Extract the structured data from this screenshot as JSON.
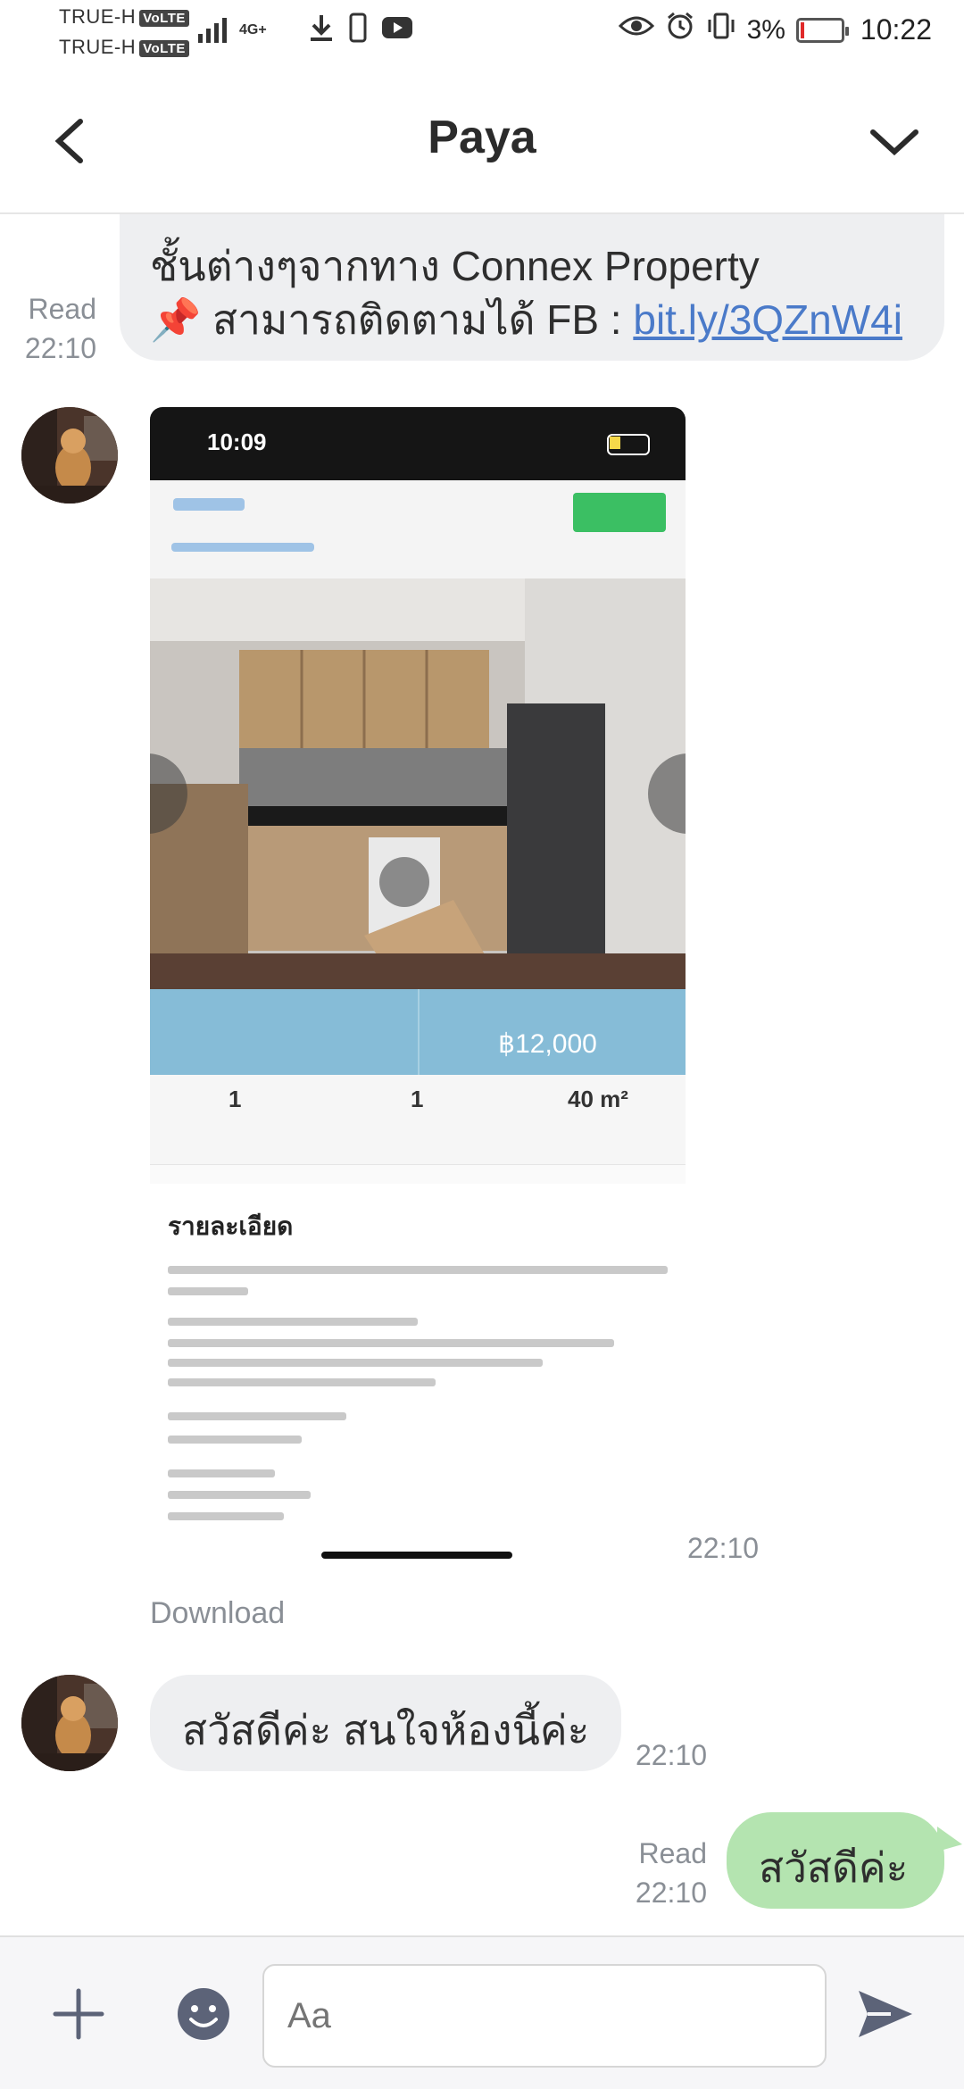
{
  "status_bar": {
    "carrier_1": "TRUE-H",
    "carrier_2": "TRUE-H",
    "volte": "VoLTE",
    "network": "4G+",
    "battery_percent": "3%",
    "time": "10:22"
  },
  "header": {
    "title": "Paya"
  },
  "messages": {
    "m1": {
      "line1": "ชั้นต่างๆจากทาง Connex Property",
      "line2_prefix": "📌 สามารถติดตามได้ FB : ",
      "link": "bit.ly/3QZnW4i",
      "status": "Read",
      "time": "22:10"
    },
    "m2": {
      "photo": {
        "phone_time": "10:09",
        "price": "฿12,000",
        "stats": [
          "1",
          "1",
          "40 m²"
        ],
        "detail_heading": "รายละเอียด"
      },
      "time": "22:10",
      "download": "Download"
    },
    "m3": {
      "text": "สวัสดีค่ะ สนใจห้องนี้ค่ะ",
      "time": "22:10"
    },
    "m4": {
      "text": "สวัสดีค่ะ",
      "status": "Read",
      "time": "22:10"
    }
  },
  "input": {
    "placeholder": "Aa"
  },
  "colors": {
    "sent_bubble": "#b4e4b0",
    "received_bubble": "#eeeff1",
    "link": "#4a7ac9"
  }
}
